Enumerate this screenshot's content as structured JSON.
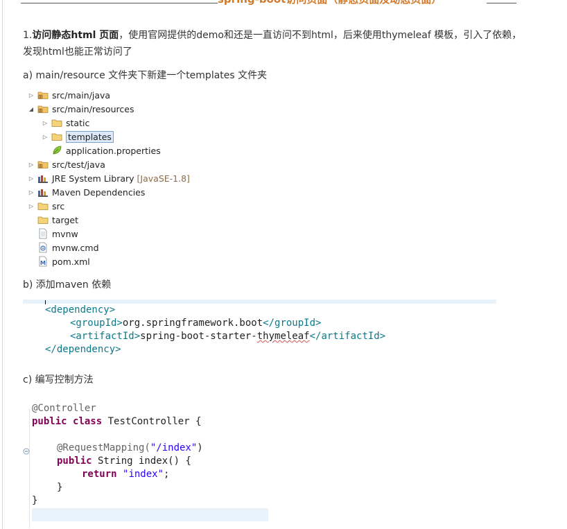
{
  "header": {
    "title": "spring-boot访问页面（静态页面及动态页面）"
  },
  "intro": {
    "number": "1.",
    "bold": "访问静态html 页面",
    "line1_rest": "，使用官网提供的demo和还是一直访问不到html，后来使用thymeleaf 模板，引入了依赖，",
    "line2": "发现html也能正常访问了"
  },
  "step_a": "a)    main/resource  文件夹下新建一个templates 文件夹",
  "tree": [
    {
      "label": "src/main/java",
      "icon": "package-folder-icon",
      "tri": "▷",
      "indent": 0
    },
    {
      "label": "src/main/resources",
      "icon": "package-folder-icon",
      "tri": "◢",
      "indent": 0
    },
    {
      "label": "static",
      "icon": "folder-icon",
      "tri": "▷",
      "indent": 1
    },
    {
      "label": "templates",
      "icon": "folder-icon",
      "tri": "▷",
      "indent": 1,
      "selected": true
    },
    {
      "label": "application.properties",
      "icon": "leaf-icon",
      "tri": "",
      "indent": 1
    },
    {
      "label": "src/test/java",
      "icon": "package-folder-icon",
      "tri": "▷",
      "indent": 0
    },
    {
      "label": "JRE System Library",
      "hint": "[JavaSE-1.8]",
      "icon": "library-icon",
      "tri": "▷",
      "indent": 0
    },
    {
      "label": "Maven Dependencies",
      "icon": "library-icon",
      "tri": "▷",
      "indent": 0
    },
    {
      "label": "src",
      "icon": "folder-icon",
      "tri": "▷",
      "indent": 0
    },
    {
      "label": "target",
      "icon": "folder-icon",
      "tri": "",
      "indent": 0
    },
    {
      "label": "mvnw",
      "icon": "file-icon",
      "tri": "",
      "indent": 0
    },
    {
      "label": "mvnw.cmd",
      "icon": "cmd-file-icon",
      "tri": "",
      "indent": 0
    },
    {
      "label": "pom.xml",
      "icon": "maven-file-icon",
      "tri": "",
      "indent": 0
    }
  ],
  "step_b": "b) 添加maven 依赖",
  "xml": {
    "dep_open": "<dependency>",
    "group_open": "<groupId>",
    "group_val": "org.springframework.boot",
    "group_close": "</groupId>",
    "art_open": "<artifactId>",
    "art_val_a": "spring-boot-starter-",
    "art_val_b": "thymeleaf",
    "art_close": "</artifactId>",
    "dep_close": "</dependency>"
  },
  "step_c": "c) 编写控制方法",
  "java": {
    "ann_controller": "@Controller",
    "kw_public": "public",
    "kw_class": "class",
    "class_name": " TestController {",
    "ann_mapping": "@RequestMapping(",
    "mapping_str": "\"/index\"",
    "mapping_close": ")",
    "kw_public2": "public",
    "method_sig": " String index() {",
    "kw_return": "return",
    "return_str": "\"index\"",
    "semicolon": ";",
    "close_method": "}",
    "close_class": "}"
  }
}
